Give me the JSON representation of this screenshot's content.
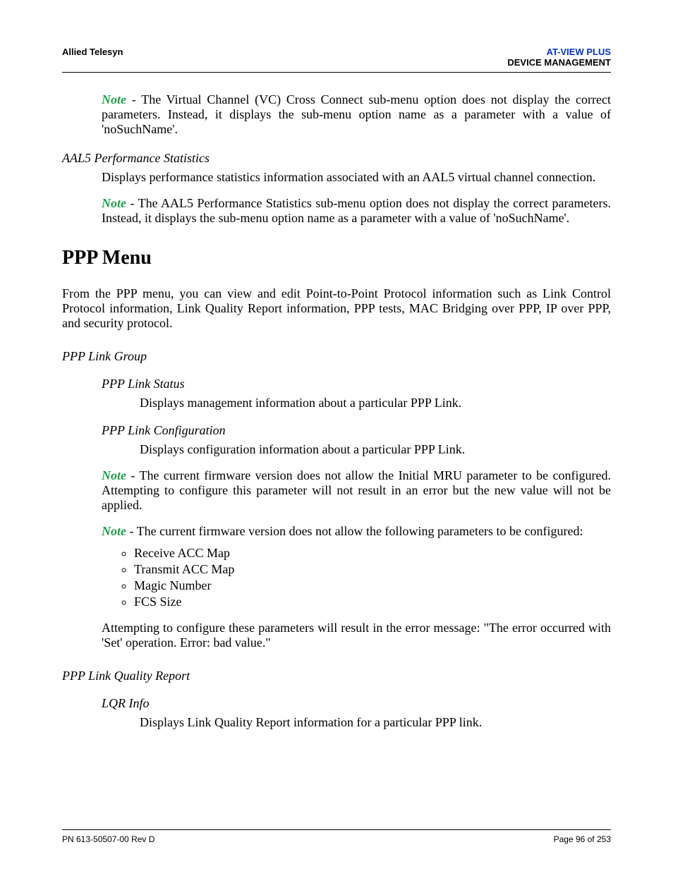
{
  "header": {
    "left": "Allied Telesyn",
    "right_line1": "AT-VIEW PLUS",
    "right_line2": "DEVICE MANAGEMENT"
  },
  "note_label": "Note",
  "sec1": {
    "note1_text": " - The Virtual Channel (VC) Cross Connect sub-menu option does not display the correct parameters. Instead, it displays the sub-menu option name as a parameter with a value of 'noSuchName'.",
    "aal5_title": "AAL5 Performance Statistics",
    "aal5_desc": "Displays performance statistics information associated with an AAL5 virtual channel connection.",
    "note2_text": " - The AAL5 Performance Statistics sub-menu option does not display the correct parameters. Instead, it displays the sub-menu option name as a parameter with a value of 'noSuchName'."
  },
  "ppp": {
    "heading": "PPP Menu",
    "intro": "From the PPP menu, you can view and edit Point-to-Point Protocol information such as Link Control Protocol information, Link Quality Report information, PPP tests, MAC Bridging over PPP, IP over PPP, and security protocol.",
    "link_group_title": "PPP Link Group",
    "link_status_title": "PPP Link Status",
    "link_status_desc": "Displays management information about a particular PPP Link.",
    "link_config_title": "PPP Link Configuration",
    "link_config_desc": "Displays configuration information about a particular PPP Link.",
    "note_mru": " - The current firmware version does not allow the Initial MRU parameter to be configured. Attempting to configure this parameter will not result in an error but the new value will not be applied.",
    "note_params": " - The current firmware version does not allow the following parameters to be configured:",
    "bullets": [
      "Receive ACC Map",
      "Transmit ACC Map",
      "Magic Number",
      "FCS Size"
    ],
    "attempt_text": "Attempting to configure these parameters will result in the error message: \"The error occurred with 'Set' operation. Error: bad value.\"",
    "lqr_title": "PPP Link Quality Report",
    "lqr_info_title": "LQR Info",
    "lqr_info_desc": "Displays Link Quality Report information for a particular PPP link."
  },
  "footer": {
    "left": "PN 613-50507-00 Rev D",
    "right": "Page 96 of 253"
  }
}
